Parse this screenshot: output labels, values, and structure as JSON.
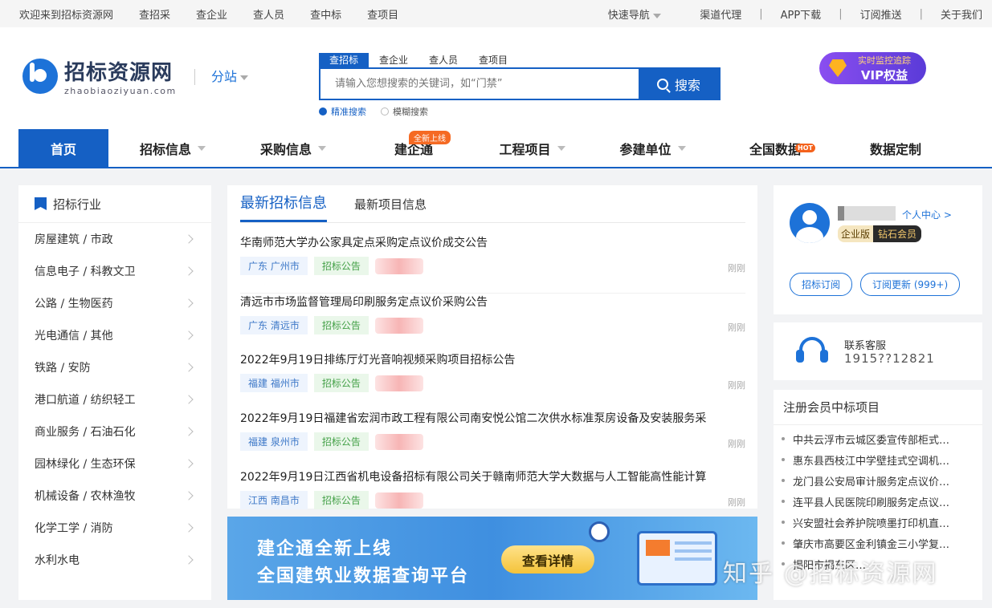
{
  "topbar": {
    "left": [
      "欢迎来到招标资源网",
      "查招采",
      "查企业",
      "查人员",
      "查中标",
      "查项目"
    ],
    "quick_nav": "快速导航",
    "channel": "渠道代理",
    "app": "APP下载",
    "subscribe": "订阅推送",
    "about": "关于我们"
  },
  "logo": {
    "cn": "招标资源网",
    "en": "zhaobiaoziyuan.com"
  },
  "branch": "分站",
  "search": {
    "tabs": [
      "查招标",
      "查企业",
      "查人员",
      "查项目"
    ],
    "placeholder": "请输入您想搜索的关键词，如“门禁”",
    "button": "搜索",
    "opt_exact": "精准搜索",
    "opt_fuzzy": "模糊搜索"
  },
  "vip": {
    "line1": "实时监控追踪",
    "line2": "VIP权益"
  },
  "nav": {
    "home": "首页",
    "bid": "招标信息",
    "purchase": "采购信息",
    "jqt": "建企通",
    "jqt_badge": "全新上线",
    "project": "工程项目",
    "units": "参建单位",
    "national": "全国数据",
    "national_badge": "HOT",
    "custom": "数据定制"
  },
  "industry": {
    "title": "招标行业",
    "items": [
      "房屋建筑 / 市政",
      "信息电子 / 科教文卫",
      "公路 / 生物医药",
      "光电通信 / 其他",
      "铁路 / 安防",
      "港口航道 / 纺织轻工",
      "商业服务 / 石油石化",
      "园林绿化 / 生态环保",
      "机械设备 / 农林渔牧",
      "化学工学 / 消防",
      "水利水电"
    ]
  },
  "news": {
    "tab_active": "最新招标信息",
    "tab_other": "最新项目信息",
    "items": [
      {
        "title": "华南师范大学办公家具定点采购定点议价成交公告",
        "loc": "广东 广州市",
        "type": "招标公告",
        "time": "刚刚"
      },
      {
        "title": "清远市市场监督管理局印刷服务定点议价采购公告",
        "loc": "广东 清远市",
        "type": "招标公告",
        "time": "刚刚"
      },
      {
        "title": "2022年9月19日排练厅灯光音响视频采购项目招标公告",
        "loc": "福建 福州市",
        "type": "招标公告",
        "time": "刚刚"
      },
      {
        "title": "2022年9月19日福建省宏润市政工程有限公司南安悦公馆二次供水标准泵房设备及安装服务采",
        "loc": "福建 泉州市",
        "type": "招标公告",
        "time": "刚刚"
      },
      {
        "title": "2022年9月19日江西省机电设备招标有限公司关于赣南师范大学大数据与人工智能高性能计算",
        "loc": "江西 南昌市",
        "type": "招标公告",
        "time": "刚刚"
      }
    ]
  },
  "banner": {
    "line1": "建企通全新上线",
    "line2": "全国建筑业数据查询平台",
    "button": "查看详情"
  },
  "user": {
    "center": "个人中心 >",
    "edition": "企业版",
    "level": "钻石会员",
    "btn_sub": "招标订阅",
    "btn_update": "订阅更新 (999+)"
  },
  "service": {
    "label": "联系客服",
    "phone": "1915??12821"
  },
  "winners": {
    "title": "注册会员中标项目",
    "items": [
      "中共云浮市云城区委宣传部柜式…",
      "惠东县西枝江中学壁挂式空调机…",
      "龙门县公安局审计服务定点议价…",
      "连平县人民医院印刷服务定点议…",
      "兴安盟社会养护院喷墨打印机直…",
      "肇庆市高要区金利镇金三小学复…",
      "揭阳市揭东区…"
    ]
  },
  "watermark": "知乎 @招标资源网"
}
